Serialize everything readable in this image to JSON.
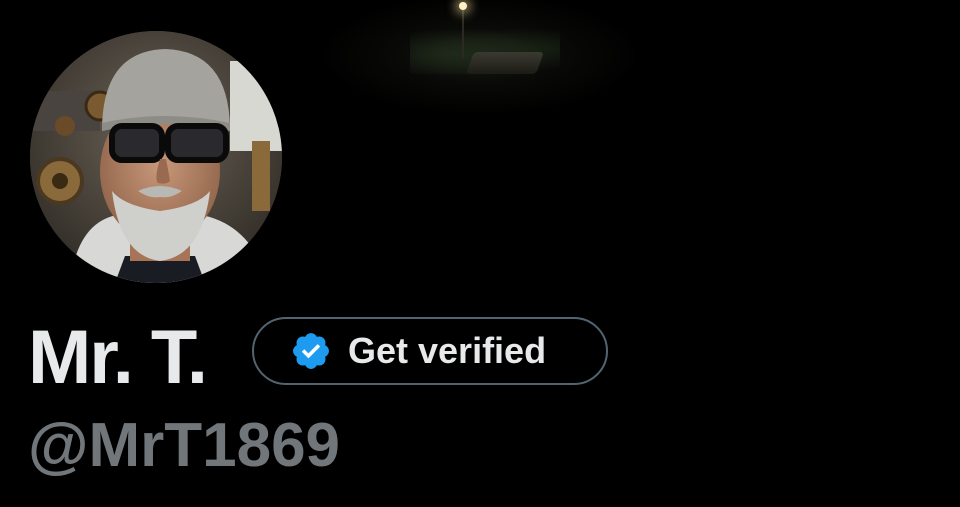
{
  "profile": {
    "display_name": "Mr. T.",
    "handle": "@MrT1869",
    "avatar_icon": "profile-photo",
    "banner_icon": "night-street-banner"
  },
  "verify_button": {
    "label": "Get verified",
    "icon": "verified-badge-icon",
    "badge_color": "#1d9bf0"
  },
  "top_bar": {
    "icons": [
      "back-arrow-icon",
      "search-icon",
      "refresh-icon",
      "more-icon"
    ]
  },
  "colors": {
    "background": "#000000",
    "name_text": "#e7e9ea",
    "handle_text": "#71767b",
    "button_border": "#536471"
  }
}
